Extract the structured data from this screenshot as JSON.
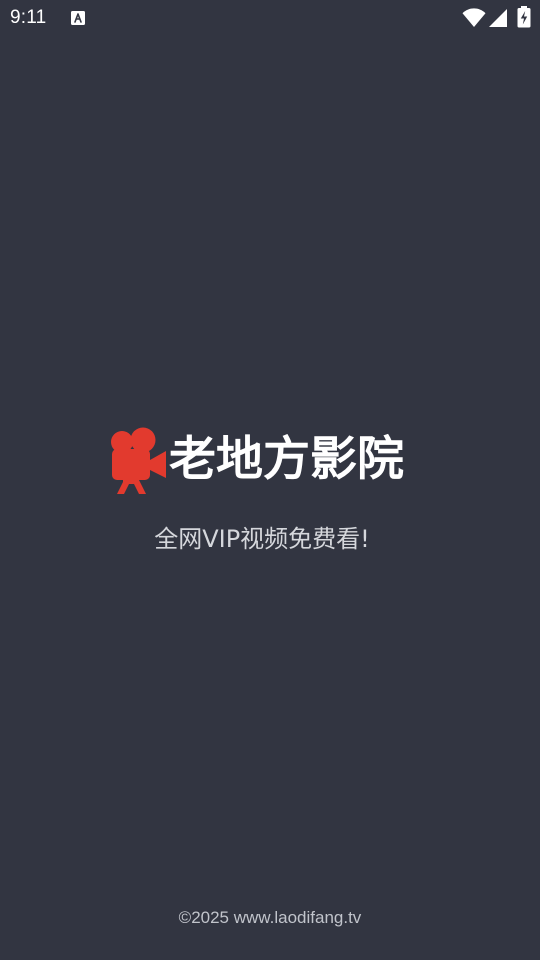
{
  "status_bar": {
    "time": "9:11",
    "notification_icon": "keyboard-a-icon",
    "icons": [
      "wifi-icon",
      "cellular-signal-icon",
      "battery-charging-icon"
    ]
  },
  "brand": {
    "logo_icon": "movie-camera-icon",
    "title": "老地方影院",
    "logo_color": "#e23a2e"
  },
  "tagline": "全网VIP视频免费看!",
  "footer": {
    "copyright": "©2025 www.laodifang.tv"
  },
  "colors": {
    "background": "#323541",
    "text": "#ffffff",
    "tagline": "#d5d7dc",
    "footer": "#c1c4cb"
  }
}
